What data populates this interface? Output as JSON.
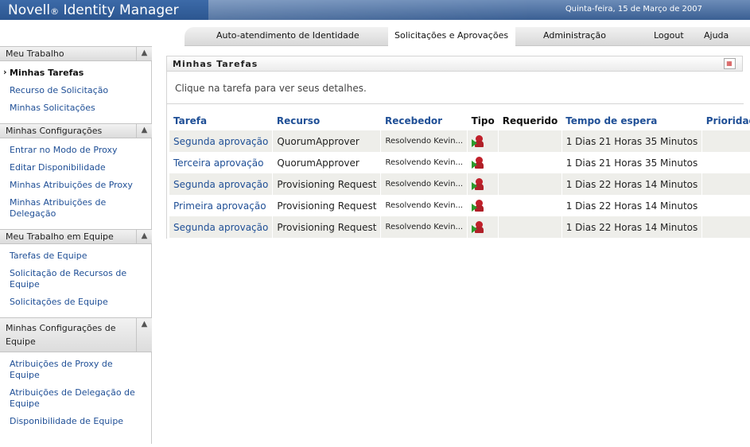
{
  "header": {
    "brand": "Novell",
    "brand_mark": "®",
    "product": "Identity Manager",
    "date": "Quinta-feira, 15 de Março de 2007"
  },
  "nav": {
    "items": [
      {
        "label": "Auto-atendimento de Identidade"
      },
      {
        "label": "Solicitações e Aprovações"
      },
      {
        "label": "Administração"
      },
      {
        "label": "Logout"
      },
      {
        "label": "Ajuda"
      }
    ]
  },
  "sidebar": {
    "sections": [
      {
        "title": "Meu Trabalho",
        "items": [
          {
            "label": "Minhas Tarefas"
          },
          {
            "label": "Recurso de Solicitação"
          },
          {
            "label": "Minhas Solicitações"
          }
        ]
      },
      {
        "title": "Minhas Configurações",
        "items": [
          {
            "label": "Entrar no Modo de Proxy"
          },
          {
            "label": "Editar Disponibilidade"
          },
          {
            "label": "Minhas Atribuições de Proxy"
          },
          {
            "label": "Minhas Atribuições de Delegação"
          }
        ]
      },
      {
        "title": "Meu Trabalho em Equipe",
        "items": [
          {
            "label": "Tarefas de Equipe"
          },
          {
            "label": "Solicitação de Recursos de Equipe"
          },
          {
            "label": "Solicitações de Equipe"
          }
        ]
      },
      {
        "title": "Minhas Configurações de Equipe",
        "items": [
          {
            "label": "Atribuições de Proxy de Equipe"
          },
          {
            "label": "Atribuições de Delegação de Equipe"
          },
          {
            "label": "Disponibilidade de Equipe"
          }
        ]
      }
    ]
  },
  "main": {
    "panel_title": "Minhas Tarefas",
    "hint": "Clique na tarefa para ver seus detalhes.",
    "columns": [
      "Tarefa",
      "Recurso",
      "Recebedor",
      "Tipo",
      "Requerido",
      "Tempo de espera",
      "Prioridade"
    ],
    "rows": [
      {
        "task": "Segunda aprovação",
        "resource": "QuorumApprover",
        "recipient": "Resolvendo Kevin...",
        "type_icon": "user-approval-icon",
        "required": "",
        "wait": "1 Dias 21 Horas 35 Minutos",
        "priority": ""
      },
      {
        "task": "Terceira aprovação",
        "resource": "QuorumApprover",
        "recipient": "Resolvendo Kevin...",
        "type_icon": "user-approval-icon",
        "required": "",
        "wait": "1 Dias 21 Horas 35 Minutos",
        "priority": ""
      },
      {
        "task": "Segunda aprovação",
        "resource": "Provisioning Request",
        "recipient": "Resolvendo Kevin...",
        "type_icon": "user-approval-icon",
        "required": "",
        "wait": "1 Dias 22 Horas 14 Minutos",
        "priority": ""
      },
      {
        "task": "Primeira aprovação",
        "resource": "Provisioning Request",
        "recipient": "Resolvendo Kevin...",
        "type_icon": "user-approval-icon",
        "required": "",
        "wait": "1 Dias 22 Horas 14 Minutos",
        "priority": ""
      },
      {
        "task": "Segunda aprovação",
        "resource": "Provisioning Request",
        "recipient": "Resolvendo Kevin...",
        "type_icon": "user-approval-icon",
        "required": "",
        "wait": "1 Dias 22 Horas 14 Minutos",
        "priority": ""
      }
    ]
  }
}
